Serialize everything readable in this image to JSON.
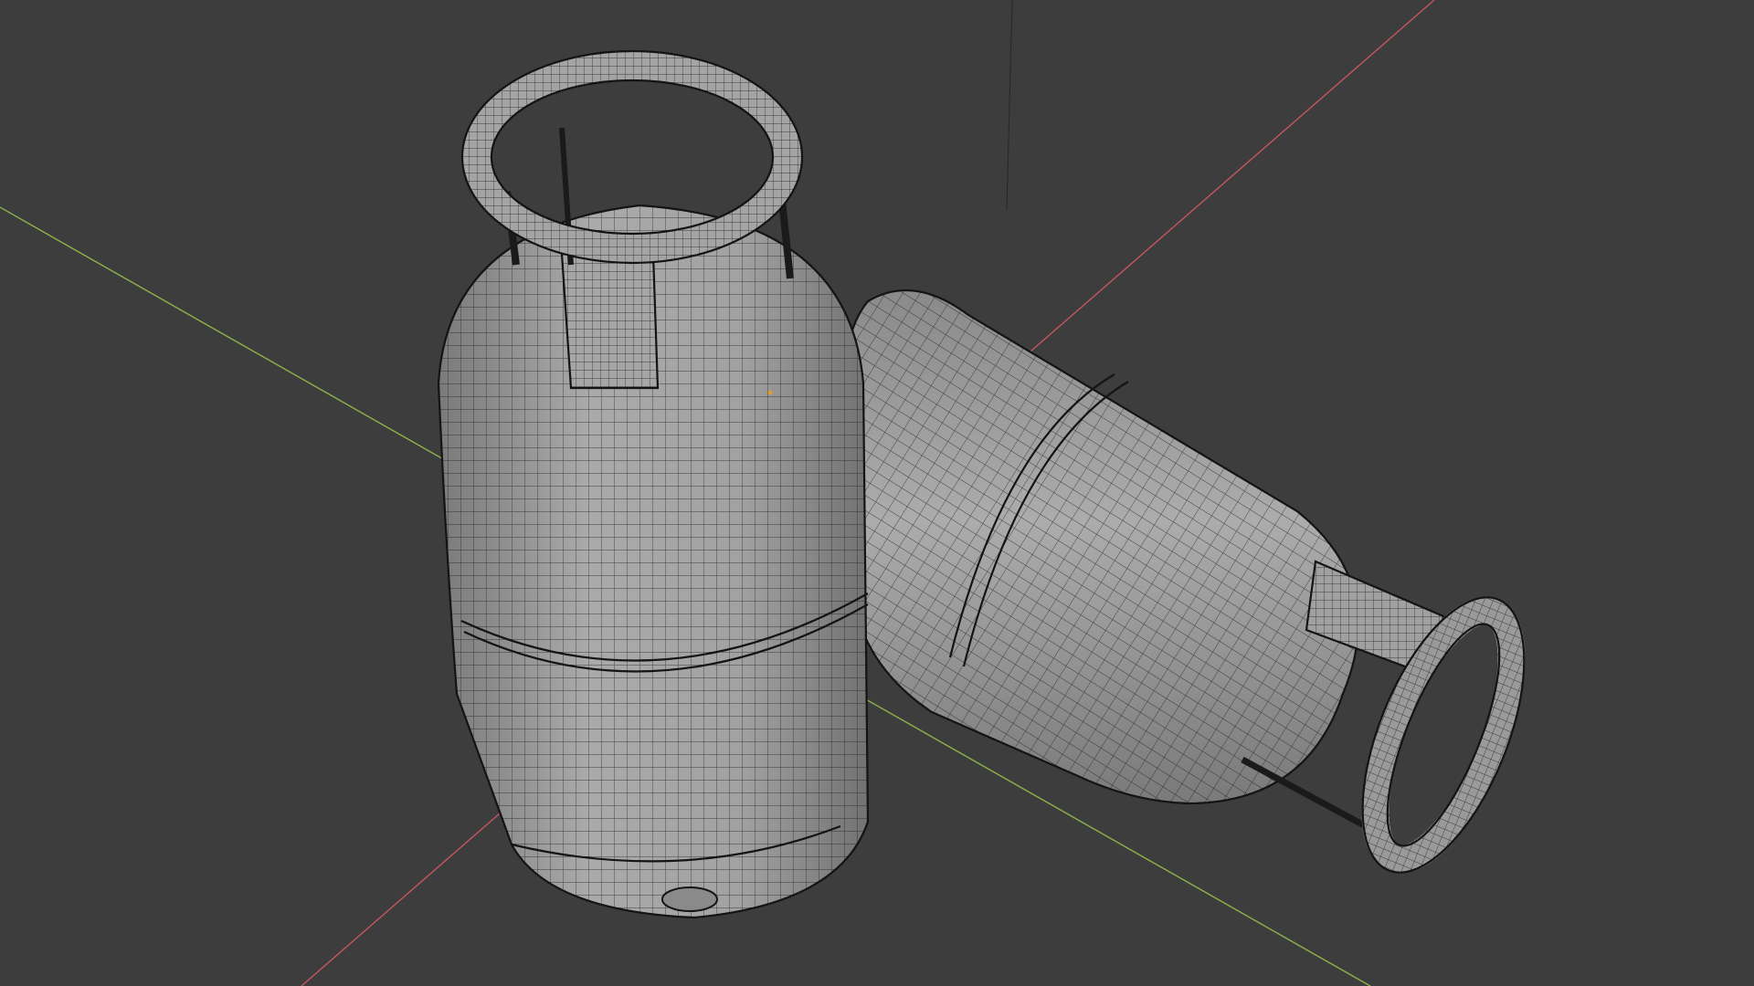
{
  "viewport": {
    "background_color": "#3d3d3d",
    "x_axis_color": "#c4565f",
    "y_axis_color": "#8db34a",
    "z_axis_color": "#2a2a2a",
    "mesh_fill_color": "#9e9e9e",
    "wire_color": "#1a1a1a",
    "origin_marker_color": "#e89a2c",
    "display_mode": "wireframe-overlay",
    "objects": [
      {
        "name": "gas-cylinder-upright",
        "orientation": "upright"
      },
      {
        "name": "gas-cylinder-lying",
        "orientation": "lying"
      }
    ]
  }
}
